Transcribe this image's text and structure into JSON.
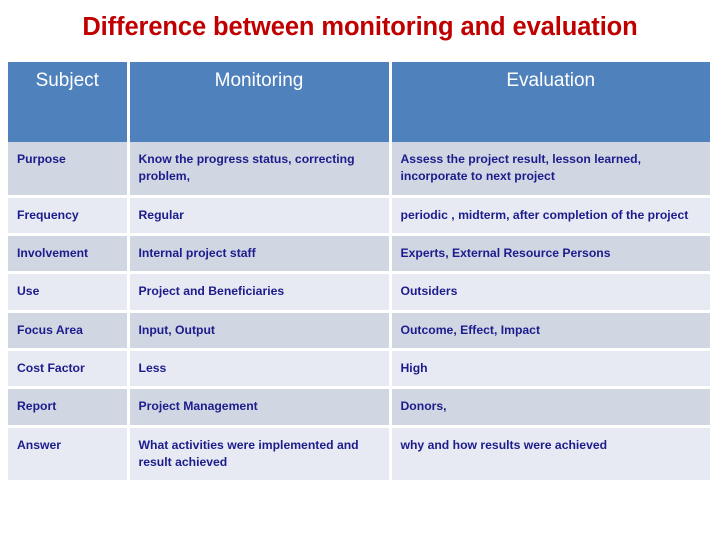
{
  "slide": {
    "title": "Difference between monitoring and evaluation",
    "title_color": "#C00000"
  },
  "theme": {
    "header_bg": "#4F81BD",
    "header_text": "#FFFFFF",
    "row_dark_bg": "#D1D6E3",
    "row_light_bg": "#E7EAF2",
    "body_text": "#1C1C8C",
    "gridline": "#FFFFFF"
  },
  "table": {
    "headers": [
      "Subject",
      "Monitoring",
      "Evaluation"
    ],
    "rows": [
      {
        "subject": "Purpose",
        "monitoring": "Know the progress status, correcting problem,",
        "evaluation": "Assess the project result, lesson learned, incorporate to next project"
      },
      {
        "subject": "Frequency",
        "monitoring": "Regular",
        "evaluation": "periodic , midterm, after completion of the project"
      },
      {
        "subject": "Involvement",
        "monitoring": "Internal project staff",
        "evaluation": "Experts, External Resource Persons"
      },
      {
        "subject": "Use",
        "monitoring": "Project and Beneficiaries",
        "evaluation": "Outsiders"
      },
      {
        "subject": "Focus Area",
        "monitoring": "Input, Output",
        "evaluation": "Outcome, Effect, Impact"
      },
      {
        "subject": "Cost Factor",
        "monitoring": "Less",
        "evaluation": "High"
      },
      {
        "subject": "Report",
        "monitoring": "Project Management",
        "evaluation": "Donors,"
      },
      {
        "subject": "Answer",
        "monitoring": "What activities were implemented and result achieved",
        "evaluation": "why and how results were achieved"
      }
    ]
  }
}
